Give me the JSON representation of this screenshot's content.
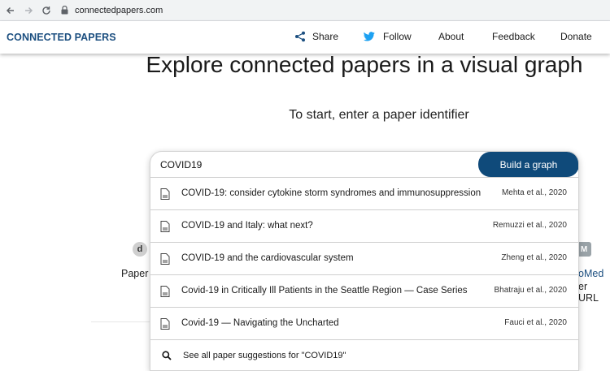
{
  "browser": {
    "url": "connectedpapers.com"
  },
  "header": {
    "logo": "CONNECTED PAPERS",
    "nav": {
      "share": "Share",
      "follow": "Follow",
      "about": "About",
      "feedback": "Feedback",
      "donate": "Donate"
    }
  },
  "hero": {
    "title": "Explore connected papers in a visual graph",
    "subtitle": "To start, enter a paper identifier"
  },
  "search": {
    "value": "COVID19",
    "button_label": "Build a graph",
    "see_all": "See all paper suggestions for \"COVID19\""
  },
  "suggestions": [
    {
      "title": "COVID-19: consider cytokine storm syndromes and immunosuppression",
      "author": "Mehta et al., 2020"
    },
    {
      "title": "COVID-19 and Italy: what next?",
      "author": "Remuzzi et al., 2020"
    },
    {
      "title": "COVID-19 and the cardiovascular system",
      "author": "Zheng et al., 2020"
    },
    {
      "title": "Covid-19 in Critically Ill Patients in the Seattle Region — Case Series",
      "author": "Bhatraju et al., 2020"
    },
    {
      "title": "Covid-19 — Navigating the Uncharted",
      "author": "Fauci et al., 2020"
    }
  ],
  "side": {
    "left_icon_text": "d",
    "left_label": "Paper",
    "right_icon_text": "M",
    "right_label_1": "oMed",
    "right_label_2": "er URL"
  },
  "colors": {
    "brand": "#1c4f80",
    "button": "#0f4a7a",
    "twitter": "#1da1f2"
  },
  "icons": [
    "back-arrow-icon",
    "forward-arrow-icon",
    "reload-icon",
    "lock-icon",
    "share-icon",
    "twitter-icon",
    "document-icon",
    "search-icon"
  ]
}
